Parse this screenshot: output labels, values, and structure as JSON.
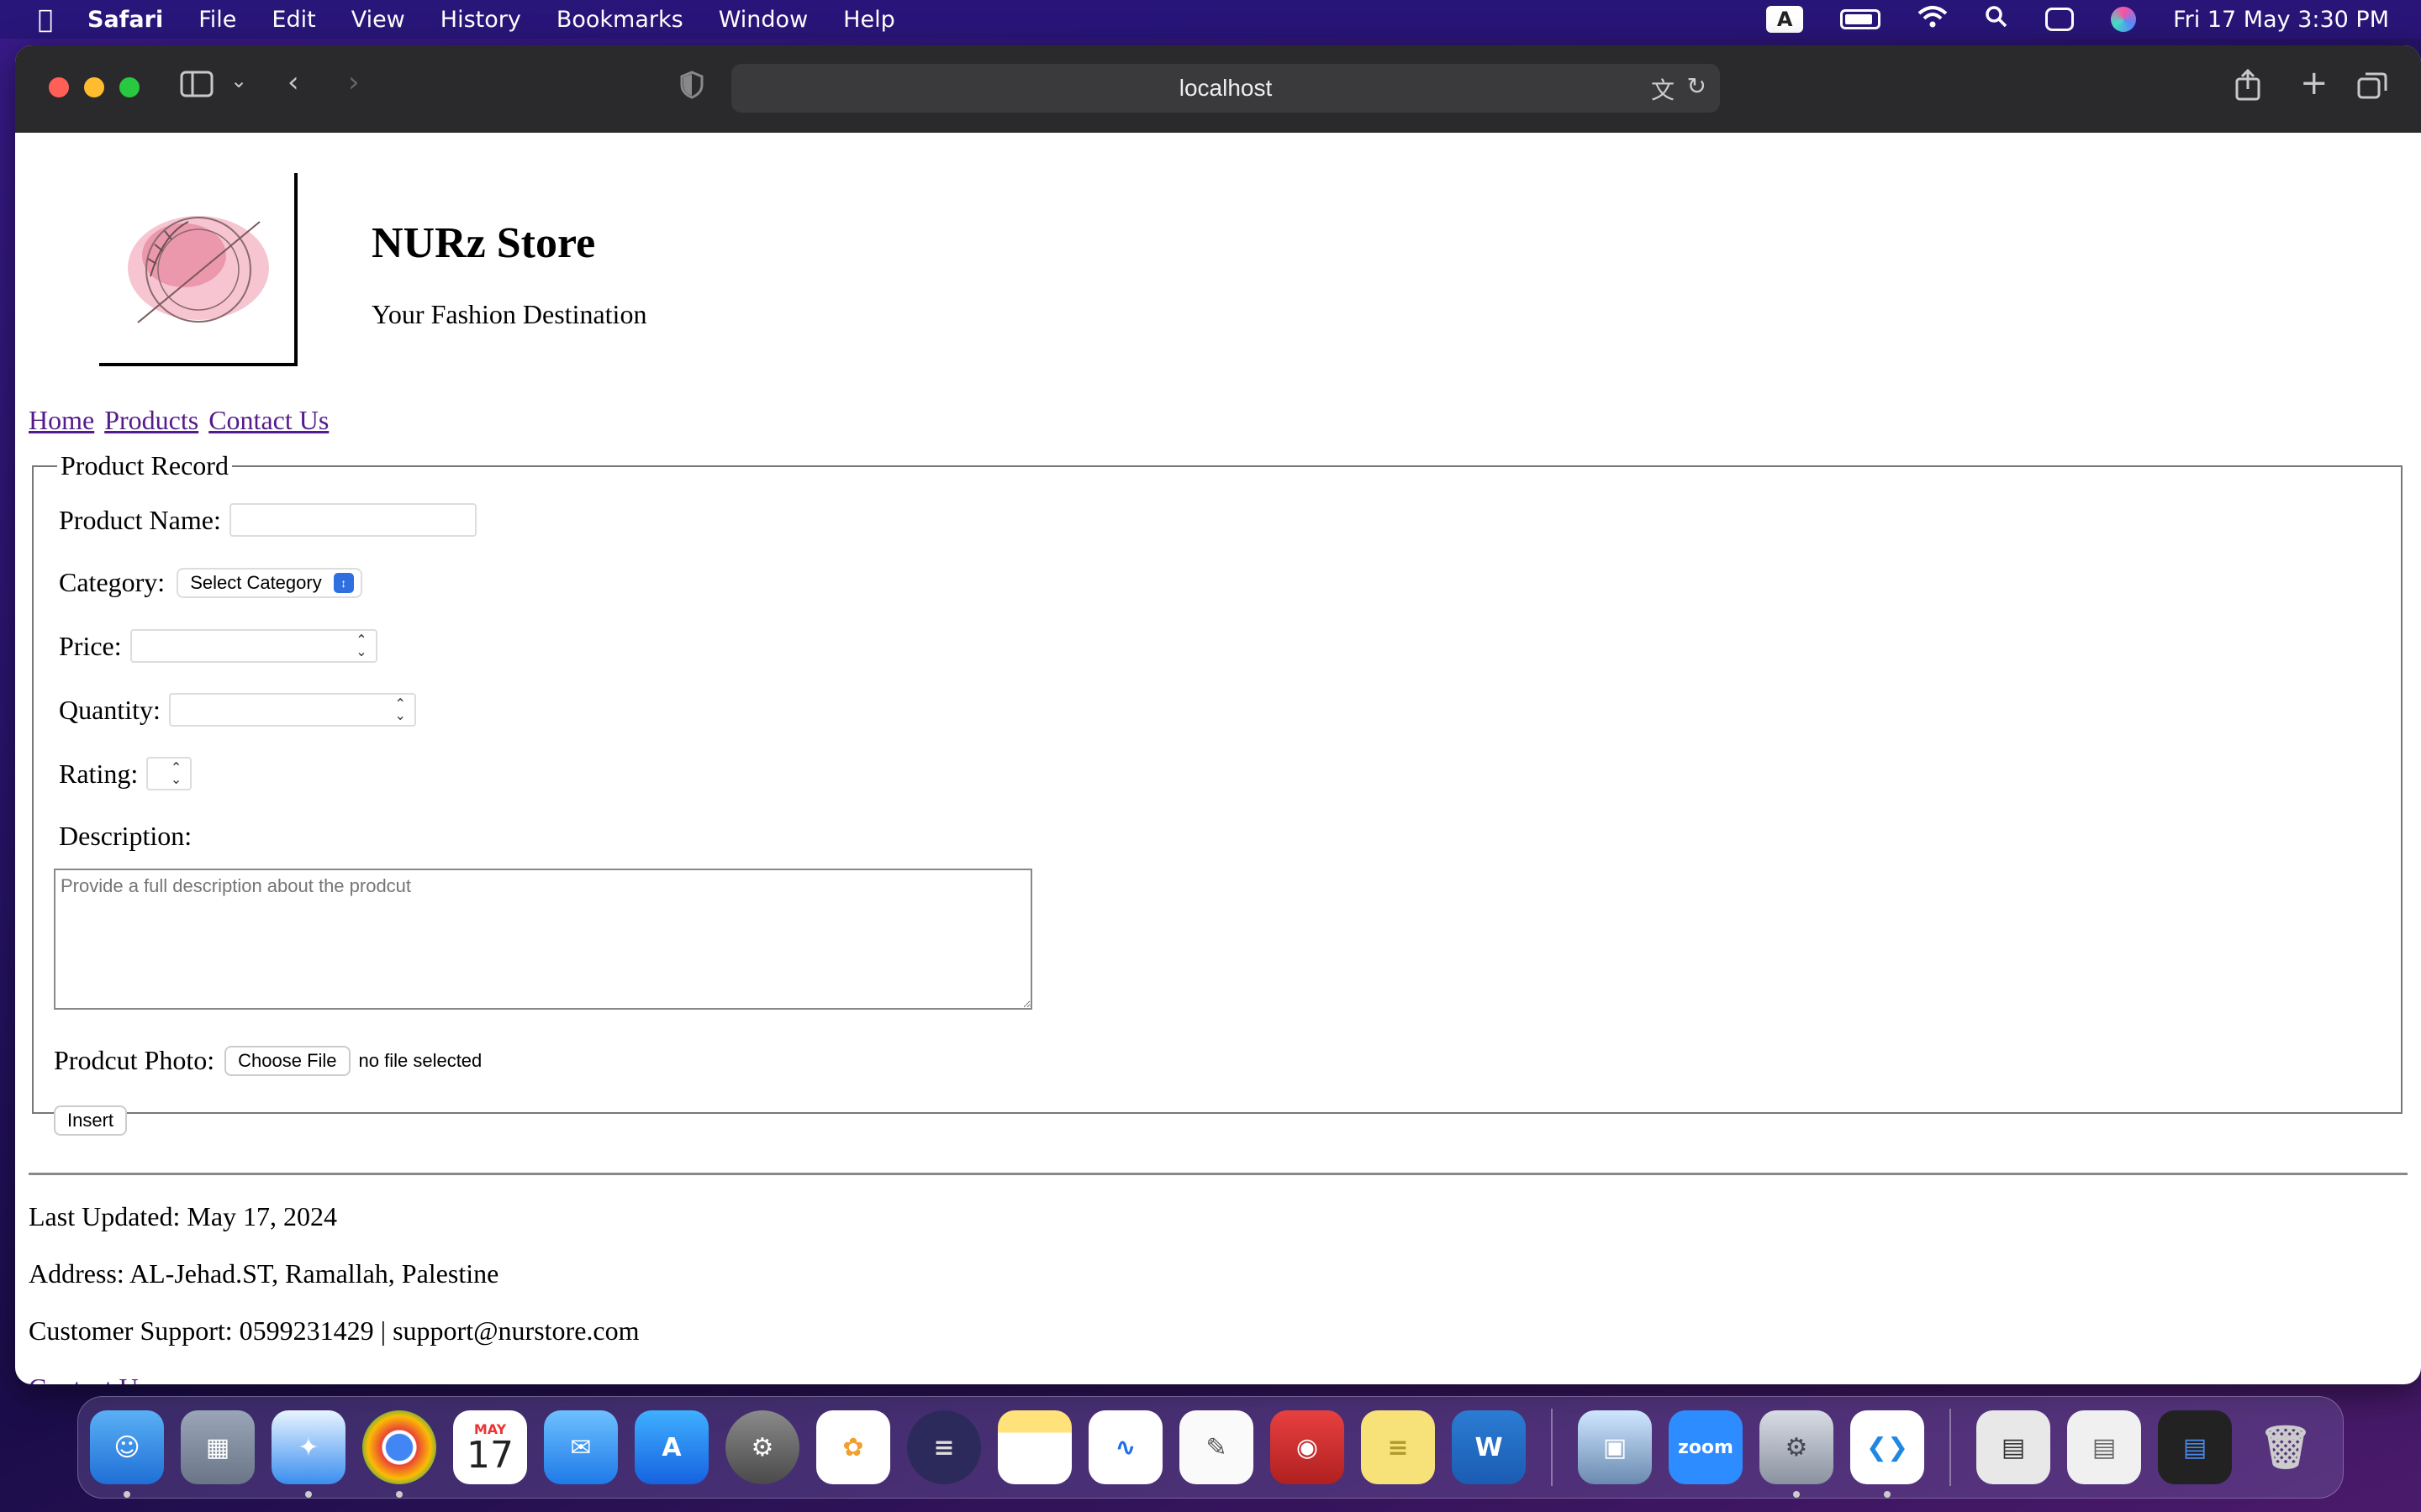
{
  "menubar": {
    "app": "Safari",
    "items": [
      "File",
      "Edit",
      "View",
      "History",
      "Bookmarks",
      "Window",
      "Help"
    ],
    "input_badge": "A",
    "datetime": "Fri 17 May  3:30 PM"
  },
  "browser": {
    "url": "localhost"
  },
  "page": {
    "store_name": "NURz Store",
    "tagline": "Your Fashion Destination",
    "nav": [
      "Home",
      "Products",
      "Contact Us"
    ],
    "form": {
      "legend": "Product Record",
      "product_name_label": "Product Name:",
      "product_name_value": "",
      "category_label": "Category:",
      "category_selected": "Select Category",
      "price_label": "Price:",
      "quantity_label": "Quantity:",
      "rating_label": "Rating:",
      "description_label": "Description:",
      "description_placeholder": "Provide a full description about the prodcut",
      "photo_label": "Prodcut Photo:",
      "choose_file": "Choose File",
      "no_file": "no file selected",
      "insert": "Insert"
    },
    "footer": {
      "updated": "Last Updated: May 17, 2024",
      "address": "Address: AL-Jehad.ST, Ramallah, Palestine",
      "support": "Customer Support: 0599231429 | support@nurstore.com",
      "contact_link": "Contact Us"
    }
  },
  "dock": {
    "calendar_month": "MAY",
    "calendar_day": "17",
    "zoom_label": "zoom",
    "word_label": "W"
  }
}
